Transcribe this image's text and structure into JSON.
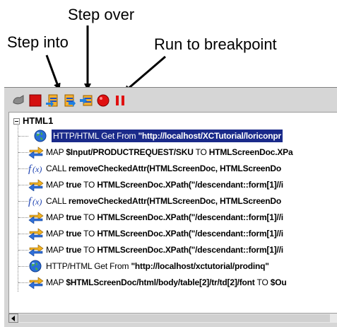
{
  "callouts": {
    "step_over": "Step over",
    "step_into": "Step into",
    "run_to_breakpoint": "Run to breakpoint"
  },
  "toolbar": {
    "buttons": [
      {
        "name": "resume-icon",
        "color": "#808080"
      },
      {
        "name": "stop-icon",
        "color": "#cc0000"
      },
      {
        "name": "step-into-icon",
        "color": "#f0a020"
      },
      {
        "name": "step-over-icon",
        "color": "#f0a020"
      },
      {
        "name": "run-to-breakpoint-icon",
        "color": "#f0a020"
      },
      {
        "name": "breakpoint-icon",
        "color": "#dd1111"
      },
      {
        "name": "pause-icon",
        "color": "#dd1111"
      }
    ]
  },
  "tree": {
    "root_label": "HTML1",
    "rows": [
      {
        "icon": "globe-icon",
        "selected": true,
        "parts": [
          {
            "t": "HTTP/HTML Get From ",
            "b": false
          },
          {
            "t": "\"http://localhost/XCTutorial/loriconpr",
            "b": true
          }
        ]
      },
      {
        "icon": "map-arrows-icon",
        "parts": [
          {
            "t": "MAP ",
            "b": false
          },
          {
            "t": "$Input/PRODUCTREQUEST/SKU",
            "b": true
          },
          {
            "t": " TO ",
            "b": false
          },
          {
            "t": "HTMLScreenDoc.XPa",
            "b": true
          }
        ]
      },
      {
        "icon": "function-icon",
        "parts": [
          {
            "t": "CALL ",
            "b": false
          },
          {
            "t": "removeCheckedAttr(HTMLScreenDoc, HTMLScreenDo",
            "b": true
          }
        ]
      },
      {
        "icon": "map-arrows-icon",
        "parts": [
          {
            "t": "MAP ",
            "b": false
          },
          {
            "t": "true",
            "b": true
          },
          {
            "t": " TO ",
            "b": false
          },
          {
            "t": "HTMLScreenDoc.XPath(\"/descendant::form[1]//i",
            "b": true
          }
        ]
      },
      {
        "icon": "function-icon",
        "parts": [
          {
            "t": "CALL ",
            "b": false
          },
          {
            "t": "removeCheckedAttr(HTMLScreenDoc, HTMLScreenDo",
            "b": true
          }
        ]
      },
      {
        "icon": "map-arrows-icon",
        "parts": [
          {
            "t": "MAP ",
            "b": false
          },
          {
            "t": "true",
            "b": true
          },
          {
            "t": " TO ",
            "b": false
          },
          {
            "t": "HTMLScreenDoc.XPath(\"/descendant::form[1]//i",
            "b": true
          }
        ]
      },
      {
        "icon": "map-arrows-icon",
        "parts": [
          {
            "t": "MAP ",
            "b": false
          },
          {
            "t": "true",
            "b": true
          },
          {
            "t": " TO ",
            "b": false
          },
          {
            "t": "HTMLScreenDoc.XPath(\"/descendant::form[1]//i",
            "b": true
          }
        ]
      },
      {
        "icon": "map-arrows-icon",
        "parts": [
          {
            "t": "MAP ",
            "b": false
          },
          {
            "t": "true",
            "b": true
          },
          {
            "t": " TO ",
            "b": false
          },
          {
            "t": "HTMLScreenDoc.XPath(\"/descendant::form[1]//i",
            "b": true
          }
        ]
      },
      {
        "icon": "globe-icon",
        "parts": [
          {
            "t": "HTTP/HTML Get From ",
            "b": false
          },
          {
            "t": "\"http://localhost/xctutorial/prodinq\"",
            "b": true
          }
        ]
      },
      {
        "icon": "map-arrows-icon",
        "parts": [
          {
            "t": "MAP ",
            "b": false
          },
          {
            "t": "$HTMLScreenDoc/html/body/table[2]/tr/td[2]/font",
            "b": true
          },
          {
            "t": " TO ",
            "b": false
          },
          {
            "t": "$Ou",
            "b": true
          }
        ]
      }
    ]
  }
}
